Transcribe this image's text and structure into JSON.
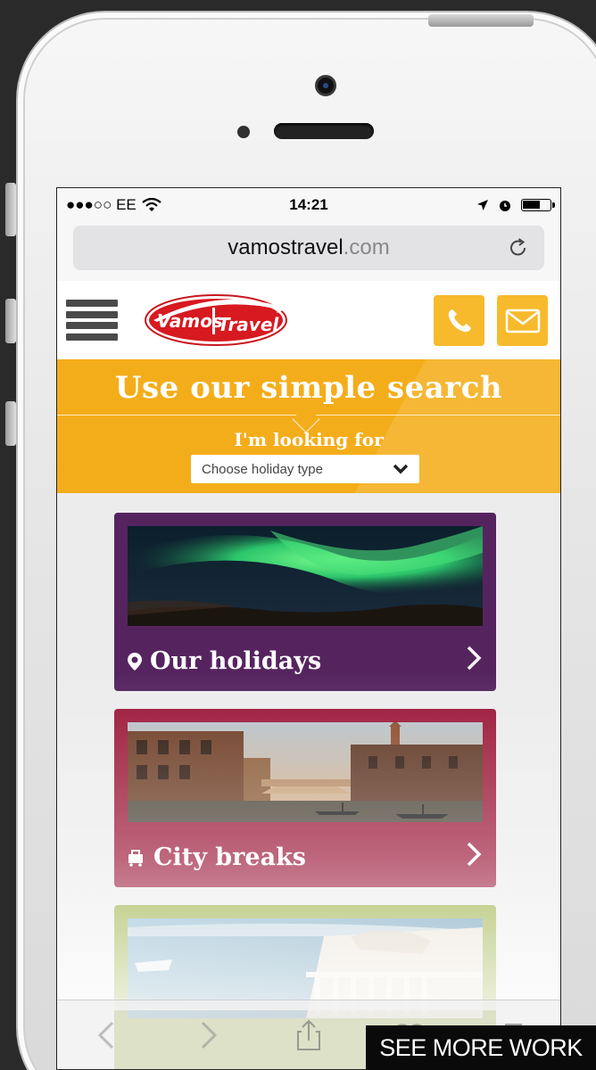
{
  "status_bar": {
    "carrier": "●●●○○ EE",
    "time": "14:21"
  },
  "url_bar": {
    "domain_main": "vamostravel",
    "domain_tld": ".com"
  },
  "site_header": {
    "logo_text_left": "Vamos",
    "logo_text_right": "Travel",
    "phone_icon": "phone-icon",
    "mail_icon": "mail-icon"
  },
  "search": {
    "title": "Use our simple search",
    "label": "I'm looking for",
    "select_value": "Choose holiday type"
  },
  "cards": [
    {
      "label": "Our holidays",
      "icon": "location-pin-icon",
      "color": "#55245f"
    },
    {
      "label": "City breaks",
      "icon": "luggage-icon",
      "color": "#9a1536"
    },
    {
      "label": "",
      "icon": "",
      "color": "#8da52a"
    }
  ],
  "overlay": {
    "see_more": "SEE MORE WORK"
  },
  "colors": {
    "accent_orange": "#f4ad1a",
    "header_button": "#f6ba2c",
    "purple": "#55245f",
    "crimson": "#9a1536",
    "lime": "#8da52a"
  }
}
